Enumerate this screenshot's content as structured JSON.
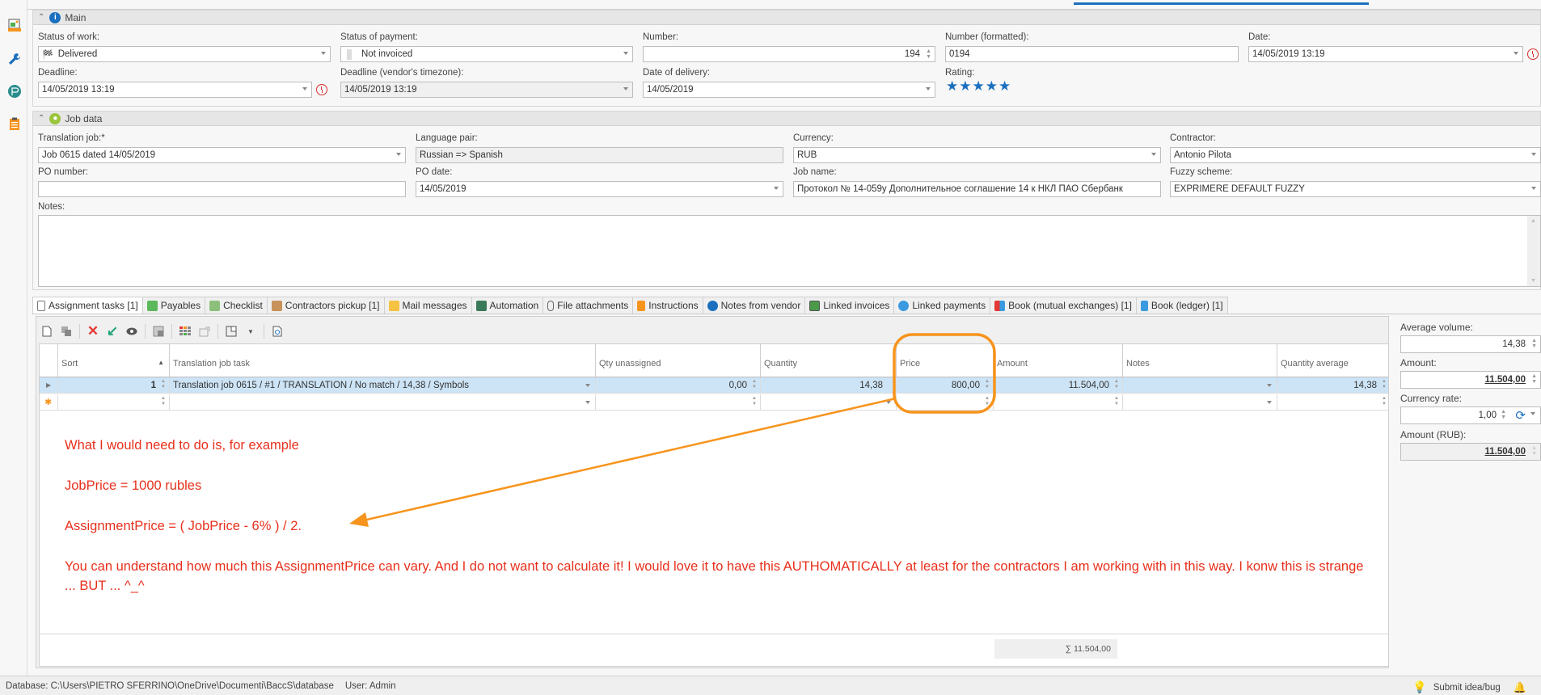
{
  "main_section": {
    "title": "Main",
    "status_of_work": {
      "label": "Status of work:",
      "value": "Delivered"
    },
    "status_of_payment": {
      "label": "Status of payment:",
      "value": "Not invoiced"
    },
    "number": {
      "label": "Number:",
      "value": "194"
    },
    "number_formatted": {
      "label": "Number (formatted):",
      "value": "0194"
    },
    "date": {
      "label": "Date:",
      "value": "14/05/2019 13:19"
    },
    "deadline": {
      "label": "Deadline:",
      "value": "14/05/2019 13:19"
    },
    "deadline_vendor": {
      "label": "Deadline (vendor's timezone):",
      "value": "14/05/2019 13:19"
    },
    "date_of_delivery": {
      "label": "Date of delivery:",
      "value": "14/05/2019"
    },
    "rating": {
      "label": "Rating:",
      "value": 5,
      "max": 5,
      "stars": "★★★★★"
    }
  },
  "job_section": {
    "title": "Job data",
    "translation_job": {
      "label": "Translation job:*",
      "value": "Job 0615 dated 14/05/2019"
    },
    "language_pair": {
      "label": "Language pair:",
      "value": "Russian => Spanish"
    },
    "currency": {
      "label": "Currency:",
      "value": "RUB"
    },
    "contractor": {
      "label": "Contractor:",
      "value": "Antonio Pilota"
    },
    "po_number": {
      "label": "PO number:",
      "value": ""
    },
    "po_date": {
      "label": "PO date:",
      "value": "14/05/2019"
    },
    "job_name": {
      "label": "Job name:",
      "value": "Протокол № 14-059у Дополнительное соглашение 14 к НКЛ ПАО Сбербанк"
    },
    "fuzzy_scheme": {
      "label": "Fuzzy scheme:",
      "value": "EXPRIMERE DEFAULT FUZZY"
    },
    "notes": {
      "label": "Notes:",
      "value": ""
    }
  },
  "tabs": [
    {
      "label": "Assignment tasks [1]",
      "icon": "list-icon",
      "active": true
    },
    {
      "label": "Payables",
      "icon": "money-bag-icon"
    },
    {
      "label": "Checklist",
      "icon": "checklist-icon"
    },
    {
      "label": "Contractors pickup [1]",
      "icon": "people-icon"
    },
    {
      "label": "Mail messages",
      "icon": "mail-icon"
    },
    {
      "label": "Automation",
      "icon": "automation-icon"
    },
    {
      "label": "File attachments",
      "icon": "paperclip-icon"
    },
    {
      "label": "Instructions",
      "icon": "instructions-icon"
    },
    {
      "label": "Notes from vendor",
      "icon": "info-icon"
    },
    {
      "label": "Linked invoices",
      "icon": "invoice-icon"
    },
    {
      "label": "Linked payments",
      "icon": "payment-icon"
    },
    {
      "label": "Book (mutual exchanges) [1]",
      "icon": "scales-icon"
    },
    {
      "label": "Book (ledger) [1]",
      "icon": "ledger-icon"
    }
  ],
  "toolbar": {
    "buttons": [
      "new-icon",
      "copy-icon",
      "delete-icon",
      "apply-icon",
      "view-icon",
      "window-icon",
      "grid-icon",
      "export-icon",
      "layout-icon",
      "dropdown-icon",
      "preview-icon"
    ]
  },
  "grid": {
    "columns": [
      "Sort",
      "Translation job task",
      "Qty unassigned",
      "Quantity",
      "Price",
      "Amount",
      "Notes",
      "Quantity average"
    ],
    "rows": [
      {
        "sort": "1",
        "task": "Translation job 0615 / #1 / TRANSLATION / No match / 14,38 / Symbols",
        "qty_unassigned": "0,00",
        "quantity": "14,38",
        "price": "800,00",
        "amount": "11.504,00",
        "notes": "",
        "quantity_average": "14,38"
      }
    ],
    "footer_sum": "∑ 11.504,00"
  },
  "annotation": {
    "line1": "What I would need to do is, for example",
    "line2": "JobPrice = 1000 rubles",
    "line3": "AssignmentPrice = ( JobPrice - 6% ) / 2.",
    "line4": "You can understand how much this AssignmentPrice can vary. And I do not want to calculate it! I would love it to have this AUTHOMATICALLY at least for the contractors I am working with in this way. I konw this is strange ... BUT ... ^_^",
    "color": "#e8301c",
    "highlight_color": "#f7941d"
  },
  "summary_panel": {
    "average_volume": {
      "label": "Average volume:",
      "value": "14,38"
    },
    "amount": {
      "label": "Amount:",
      "value": "11.504,00"
    },
    "currency_rate": {
      "label": "Currency rate:",
      "value": "1,00"
    },
    "amount_rub": {
      "label": "Amount (RUB):",
      "value": "11.504,00"
    }
  },
  "status_bar": {
    "database": "Database: C:\\Users\\PIETRO SFERRINO\\OneDrive\\Documenti\\BaccS\\database",
    "user": "User: Admin",
    "submit": "Submit idea/bug"
  }
}
